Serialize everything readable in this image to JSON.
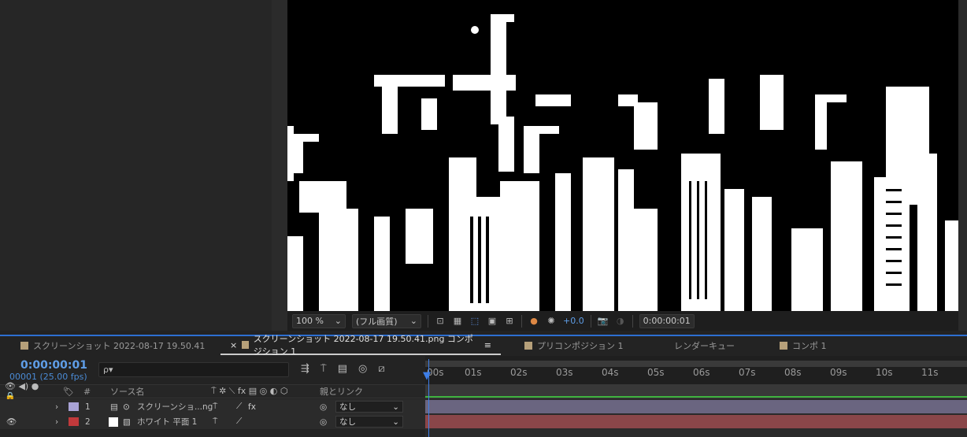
{
  "viewer": {
    "zoom": "100 %",
    "resolution": "(フル画質)",
    "exposure": "+0.0",
    "timecode": "0:00:00:01"
  },
  "tabs": [
    {
      "label": "スクリーンショット 2022-08-17 19.50.41",
      "active": false,
      "swatch": "#b6a07a"
    },
    {
      "label": "スクリーンショット 2022-08-17 19.50.41.png コンポジション 1",
      "active": true,
      "swatch": "#b6a07a"
    },
    {
      "label": "プリコンポジション 1",
      "active": false,
      "swatch": "#b6a07a"
    },
    {
      "label": "レンダーキュー",
      "active": false
    },
    {
      "label": "コンポ 1",
      "active": false,
      "swatch": "#b6a07a"
    }
  ],
  "timeline": {
    "timecode": "0:00:00:01",
    "frames": "00001 (25.00 fps)",
    "search_icon": "ρ▾",
    "header": {
      "hash": "#",
      "source_name": "ソース名",
      "parent_link": "親とリンク"
    },
    "layers": [
      {
        "num": "1",
        "name": "スクリーンショ...ng",
        "color": "#a9a3d6",
        "parent": "なし",
        "fx": "fx",
        "bar": "#6a6580"
      },
      {
        "num": "2",
        "name": "ホワイト 平面 1",
        "color": "#c0393b",
        "parent": "なし",
        "bar": "#8a4649"
      }
    ],
    "ruler": [
      "00s",
      "01s",
      "02s",
      "03s",
      "04s",
      "05s",
      "06s",
      "07s",
      "08s",
      "09s",
      "10s",
      "11s"
    ]
  }
}
